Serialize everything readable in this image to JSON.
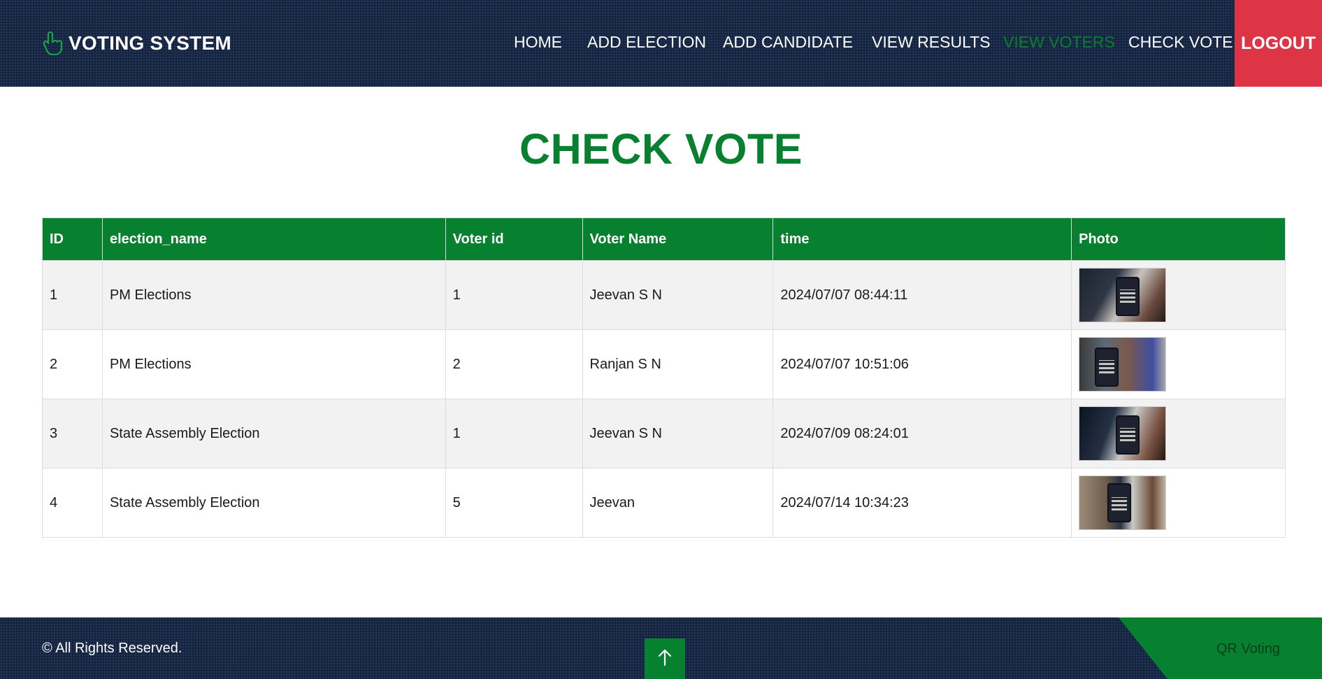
{
  "header": {
    "brand": "VOTING SYSTEM",
    "brand_icon": "hand-pointer-icon",
    "nav": {
      "home": "HOME",
      "add_election": "ADD ELECTION",
      "add_candidate": "ADD CANDIDATE",
      "view_results": "VIEW RESULTS",
      "view_voters": "VIEW VOTERS",
      "check_vote": "CHECK VOTE"
    },
    "active_nav": "view_voters",
    "logout": "LOGOUT"
  },
  "main": {
    "title": "CHECK VOTE",
    "table": {
      "columns": [
        "ID",
        "election_name",
        "Voter id",
        "Voter Name",
        "time",
        "Photo"
      ],
      "rows": [
        {
          "id": "1",
          "election_name": "PM Elections",
          "voter_id": "1",
          "voter_name": "Jeevan S N",
          "time": "2024/07/07 08:44:11"
        },
        {
          "id": "2",
          "election_name": "PM Elections",
          "voter_id": "2",
          "voter_name": "Ranjan S N",
          "time": "2024/07/07 10:51:06"
        },
        {
          "id": "3",
          "election_name": "State Assembly Election",
          "voter_id": "1",
          "voter_name": "Jeevan S N",
          "time": "2024/07/09 08:24:01"
        },
        {
          "id": "4",
          "election_name": "State Assembly Election",
          "voter_id": "5",
          "voter_name": "Jeevan",
          "time": "2024/07/14 10:34:23"
        }
      ]
    }
  },
  "footer": {
    "copyright": "© All Rights Reserved.",
    "brand": "QR Voting",
    "to_top_icon": "arrow-up-icon"
  },
  "colors": {
    "nav_bg": "#142443",
    "accent_green": "#07812f",
    "logout_red": "#dd3545"
  }
}
